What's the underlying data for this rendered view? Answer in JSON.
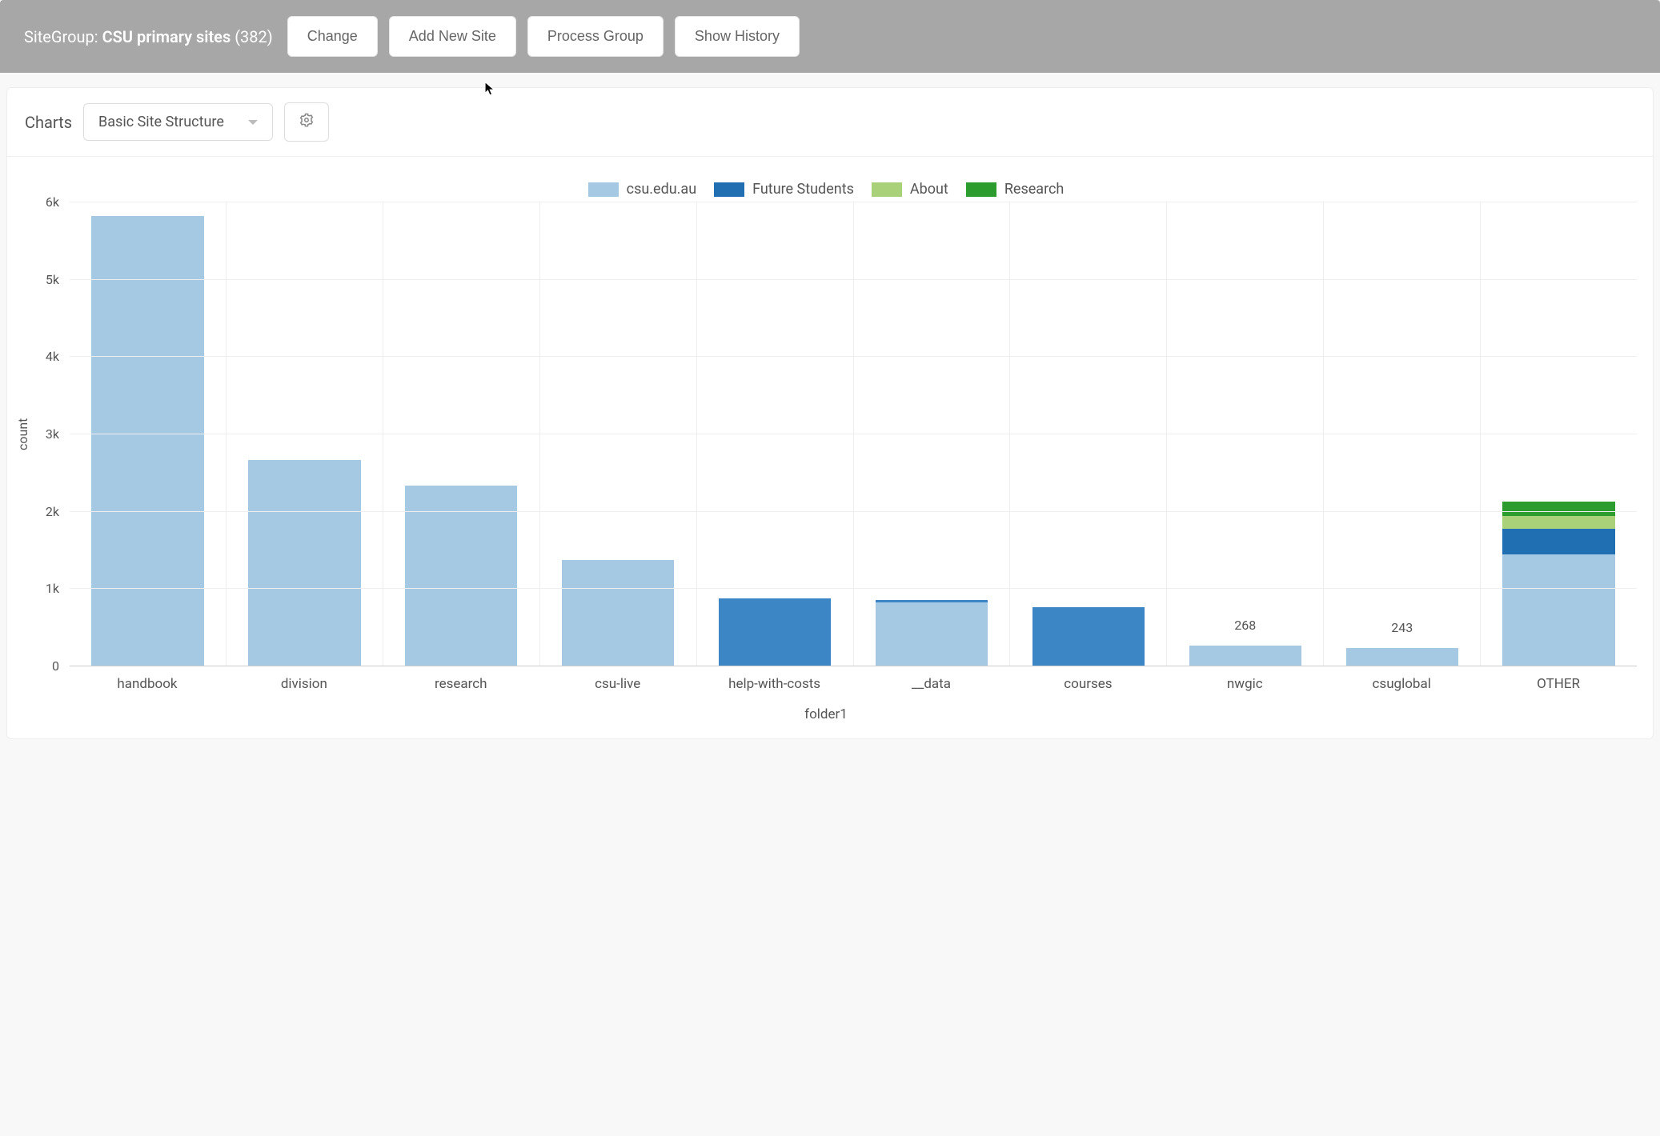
{
  "topbar": {
    "sitegroup_prefix": "SiteGroup: ",
    "sitegroup_name": "CSU primary sites",
    "sitegroup_count": "(382)",
    "change_label": "Change",
    "add_label": "Add New Site",
    "process_label": "Process Group",
    "history_label": "Show History"
  },
  "panel": {
    "title": "Charts",
    "select_value": "Basic Site Structure"
  },
  "legend": {
    "csu": "csu.edu.au",
    "future": "Future Students",
    "about": "About",
    "research": "Research"
  },
  "colors": {
    "csu": "#a5c9e3",
    "future": "#1f6fb2",
    "about": "#a8d17a",
    "research": "#2d9c2e",
    "future_alt": "#3d86c6"
  },
  "chart_data": {
    "type": "bar",
    "stacked": true,
    "xlabel": "folder1",
    "ylabel": "count",
    "ylim": [
      0,
      6000
    ],
    "y_ticks": [
      0,
      "1k",
      "2k",
      "3k",
      "4k",
      "5k",
      "6k"
    ],
    "categories": [
      "handbook",
      "division",
      "research",
      "csu-live",
      "help-with-costs",
      "__data",
      "courses",
      "nwgic",
      "csuglobal",
      "OTHER"
    ],
    "series": [
      {
        "name": "csu.edu.au",
        "values": [
          5820,
          2670,
          2340,
          1380,
          0,
          830,
          0,
          268,
          243,
          1450
        ],
        "color_key": "csu"
      },
      {
        "name": "Future Students",
        "values": [
          0,
          0,
          0,
          0,
          880,
          30,
          770,
          0,
          0,
          330
        ],
        "color_key": "future"
      },
      {
        "name": "About",
        "values": [
          0,
          0,
          0,
          0,
          0,
          0,
          0,
          0,
          0,
          170
        ],
        "color_key": "about"
      },
      {
        "name": "Research",
        "values": [
          0,
          0,
          0,
          0,
          0,
          0,
          0,
          0,
          0,
          180
        ],
        "color_key": "research"
      }
    ],
    "value_labels": {
      "7": "268",
      "8": "243"
    }
  }
}
